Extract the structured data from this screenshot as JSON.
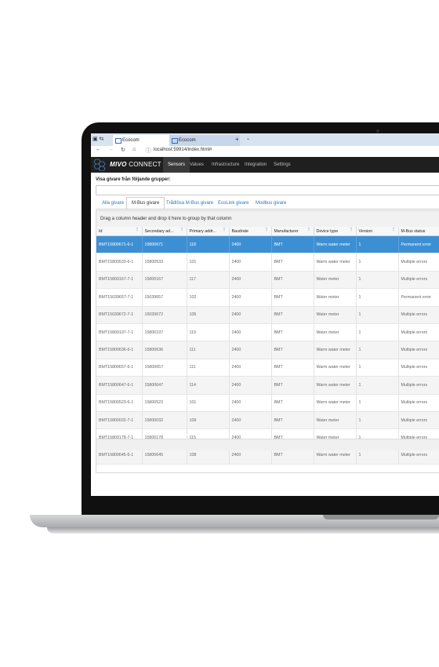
{
  "browser": {
    "tabs": [
      {
        "label": "Ecocom"
      },
      {
        "label": "Ecocom"
      }
    ],
    "new_tab": "+",
    "tab_menu": "⌄",
    "close": "✕",
    "url": "localhost:59914/index.html#"
  },
  "app": {
    "brand_bold": "MIVO",
    "brand_rest": "CONNECT",
    "menu": [
      {
        "label": "Sensors",
        "active": true
      },
      {
        "label": "Values"
      },
      {
        "label": "Infrastructure"
      },
      {
        "label": "Integration"
      },
      {
        "label": "Settings"
      }
    ]
  },
  "filter": {
    "question": "Visa givare från följande grupper:",
    "value": ""
  },
  "group_tabs": [
    {
      "label": "Alla givare"
    },
    {
      "label": "M-Bus givare",
      "selected": true
    },
    {
      "label": "Trådlösa M-Bus givare"
    },
    {
      "label": "EcoLink givare"
    },
    {
      "label": "Modbus givare"
    }
  ],
  "grid": {
    "group_hint": "Drag a column header and drop it here to group by that column",
    "columns": [
      "Id",
      "Secondary ad...",
      "Primary addr...",
      "Baudrate",
      "Manufacturer",
      "Device type",
      "Version",
      "M-Bus status"
    ],
    "rows": [
      [
        "BMT15800671-6-1",
        "15800671",
        "118",
        "2400",
        "BMT",
        "Warm water meter",
        "1",
        "Permanent error"
      ],
      [
        "BMT15800533-6-1",
        "15800533",
        "101",
        "2400",
        "BMT",
        "Warm water meter",
        "1",
        "Multiple errors"
      ],
      [
        "BMT15800167-7-1",
        "15800167",
        "117",
        "2400",
        "BMT",
        "Water meter",
        "1",
        "Multiple errors"
      ],
      [
        "BMT15039657-7-1",
        "15039657",
        "102",
        "2400",
        "BMT",
        "Water meter",
        "1",
        "Permanent error"
      ],
      [
        "BMT15039672-7-1",
        "15039672",
        "105",
        "2400",
        "BMT",
        "Water meter",
        "1",
        "Multiple errors"
      ],
      [
        "BMT15800197-7-1",
        "15800197",
        "119",
        "2400",
        "BMT",
        "Water meter",
        "1",
        "Multiple errors"
      ],
      [
        "BMT15800636-6-1",
        "15800636",
        "111",
        "2400",
        "BMT",
        "Warm water meter",
        "1",
        "Multiple errors"
      ],
      [
        "BMT15800657-6-1",
        "15800657",
        "111",
        "2400",
        "BMT",
        "Warm water meter",
        "1",
        "Multiple errors"
      ],
      [
        "BMT15800647-6-1",
        "15800647",
        "114",
        "2400",
        "BMT",
        "Warm water meter",
        "1",
        "Multiple errors"
      ],
      [
        "BMT15800523-6-1",
        "15800523",
        "101",
        "2400",
        "BMT",
        "Warm water meter",
        "1",
        "Multiple errors"
      ],
      [
        "BMT15800032-7-1",
        "15800032",
        "109",
        "2400",
        "BMT",
        "Water meter",
        "1",
        "Multiple errors"
      ],
      [
        "BMT15800178-7-1",
        "15800178",
        "115",
        "2400",
        "BMT",
        "Water meter",
        "1",
        "Multiple errors"
      ],
      [
        "BMT15800645-6-1",
        "15800645",
        "108",
        "2400",
        "BMT",
        "Warm water meter",
        "1",
        "Multiple errors"
      ]
    ],
    "selected_row": 0
  },
  "colors": {
    "header_bg": "#1f1f1f",
    "accent": "#2a74c5",
    "selected_row": "#3d8fd4"
  },
  "icons": [
    "back-arrow-icon",
    "forward-arrow-icon",
    "refresh-icon",
    "home-icon",
    "info-icon",
    "tab-page-icon",
    "column-menu-icon"
  ]
}
